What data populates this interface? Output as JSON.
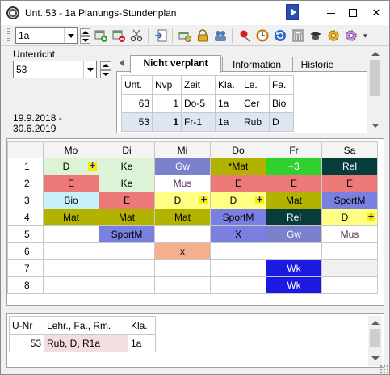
{
  "window": {
    "title": "Unt.:53 - 1a  Planungs-Stundenplan"
  },
  "toolbar": {
    "class_value": "1a",
    "icons": [
      "add-lesson-icon",
      "delete-lesson-icon",
      "cut-icon",
      "import-icon",
      "print-preview-icon",
      "lock-icon",
      "group-icon",
      "pin-icon",
      "clock-icon",
      "refresh-icon",
      "calculator-icon",
      "graduation-cap-icon",
      "settings-icon"
    ]
  },
  "left": {
    "unterricht_label": "Unterricht",
    "unterricht_value": "53",
    "date_from": "19.9.2018 -",
    "date_to": "30.6.2019"
  },
  "tabs": [
    "Nicht verplant",
    "Information",
    "Historie"
  ],
  "info_table": {
    "headers": [
      "Unt.",
      "Nvp",
      "Zeit",
      "Kla.",
      "Le.",
      "Fa."
    ],
    "rows": [
      [
        "63",
        "1",
        "Do-5",
        "1a",
        "Cer",
        "Bio"
      ],
      [
        "53",
        "1",
        "Fr-1",
        "1a",
        "Rub",
        "D"
      ]
    ]
  },
  "timetable": {
    "days": [
      "Mo",
      "Di",
      "Mi",
      "Do",
      "Fr",
      "Sa"
    ],
    "periods": [
      "1",
      "2",
      "3",
      "4",
      "5",
      "6",
      "7",
      "8"
    ],
    "cells": [
      [
        {
          "t": "D",
          "bg": "#ddf3d6",
          "plus": true
        },
        {
          "t": "Ke",
          "bg": "#ddf3d6"
        },
        {
          "t": "Gw",
          "bg": "#7a80cc",
          "fg": "#fff"
        },
        {
          "t": "*Mat",
          "bg": "#b2b200"
        },
        {
          "t": "+3",
          "bg": "#2fd12f",
          "fg": "#fff"
        },
        {
          "t": "Rel",
          "bg": "#063c3c",
          "fg": "#fff"
        }
      ],
      [
        {
          "t": "E",
          "bg": "#ec7878"
        },
        {
          "t": "Ke",
          "bg": "#ddf3d6"
        },
        {
          "t": "Mus",
          "bg": "#ffffff",
          "fg": "#5a2a5a"
        },
        {
          "t": "E",
          "bg": "#ec7878"
        },
        {
          "t": "E",
          "bg": "#ec7878"
        },
        {
          "t": "E",
          "bg": "#ec7878"
        }
      ],
      [
        {
          "t": "Bio",
          "bg": "#c8f0f8"
        },
        {
          "t": "E",
          "bg": "#ec7878"
        },
        {
          "t": "D",
          "bg": "#ffff86",
          "plus": true
        },
        {
          "t": "D",
          "bg": "#ffff86",
          "plus": true
        },
        {
          "t": "Mat",
          "bg": "#b2b200"
        },
        {
          "t": "SportM",
          "bg": "#7a80e0"
        }
      ],
      [
        {
          "t": "Mat",
          "bg": "#b2b200"
        },
        {
          "t": "Mat",
          "bg": "#b2b200"
        },
        {
          "t": "Mat",
          "bg": "#b2b200"
        },
        {
          "t": "SportM",
          "bg": "#7a80e0"
        },
        {
          "t": "Rel",
          "bg": "#063c3c",
          "fg": "#fff"
        },
        {
          "t": "D",
          "bg": "#ffff86",
          "plus": true
        }
      ],
      [
        {
          "t": "",
          "bg": "#ffffff"
        },
        {
          "t": "SportM",
          "bg": "#7a80e0"
        },
        {
          "t": "",
          "bg": "#ffffff"
        },
        {
          "t": "X",
          "bg": "#7a80e0"
        },
        {
          "t": "Gw",
          "bg": "#7a80cc",
          "fg": "#fff"
        },
        {
          "t": "Mus",
          "bg": "#ffffff",
          "fg": "#5a2a5a"
        }
      ],
      [
        {
          "t": "",
          "bg": "#ffffff"
        },
        {
          "t": "",
          "bg": "#ffffff"
        },
        {
          "t": "x",
          "bg": "#f4b08c"
        },
        {
          "t": "",
          "bg": "#ffffff"
        },
        {
          "t": "",
          "bg": "#ffffff"
        },
        {
          "t": "",
          "bg": "#ffffff"
        }
      ],
      [
        {
          "t": "",
          "bg": "#ffffff"
        },
        {
          "t": "",
          "bg": "#ffffff"
        },
        {
          "t": "",
          "bg": "#ffffff"
        },
        {
          "t": "",
          "bg": "#ffffff"
        },
        {
          "t": "Wk",
          "bg": "#1a1ae0",
          "fg": "#fff"
        },
        {
          "t": "",
          "bg": "#f0f0f0"
        }
      ],
      [
        {
          "t": "",
          "bg": "#ffffff"
        },
        {
          "t": "",
          "bg": "#ffffff"
        },
        {
          "t": "",
          "bg": "#ffffff"
        },
        {
          "t": "",
          "bg": "#ffffff"
        },
        {
          "t": "Wk",
          "bg": "#1a1ae0",
          "fg": "#fff"
        },
        {
          "t": "",
          "bg": "#ffffff"
        }
      ]
    ]
  },
  "bottom_table": {
    "headers": [
      "U-Nr",
      "Lehr., Fa., Rm.",
      "Kla."
    ],
    "row": [
      "53",
      "Rub, D, R1a",
      "1a"
    ]
  }
}
